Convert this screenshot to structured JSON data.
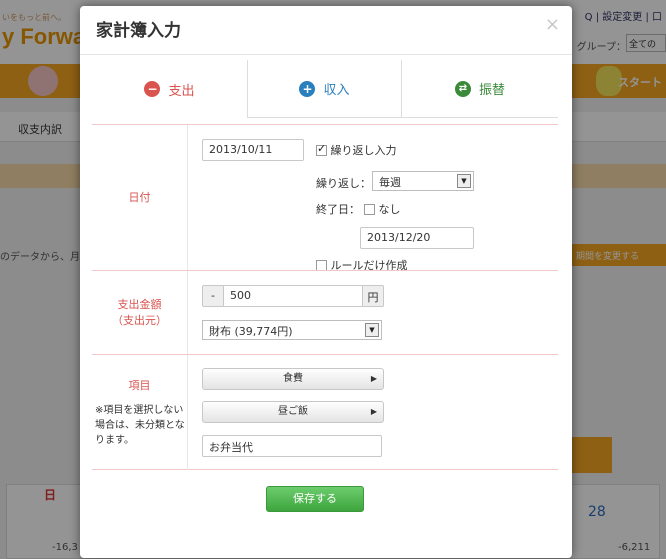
{
  "background": {
    "logo_tagline": "いをもっと前へ。",
    "logo_text": "y Forwa",
    "top_links": "Q | 設定変更 | 口",
    "group_label": "グループ：",
    "group_select": "全ての",
    "start_label": "スタート",
    "tab_label": "収支内訳",
    "text_left": "のデータから、月",
    "btn_right": "期間を変更する",
    "sunday": "日",
    "day_28": "28",
    "neg_left": "-16,3",
    "neg_right": "-6,211"
  },
  "modal": {
    "title": "家計簿入力",
    "close": "×",
    "tabs": [
      {
        "label": "支出",
        "icon": "minus-circle-icon",
        "icon_glyph": "−",
        "color": "#d9534f"
      },
      {
        "label": "収入",
        "icon": "plus-circle-icon",
        "icon_glyph": "+",
        "color": "#2a7fbd"
      },
      {
        "label": "振替",
        "icon": "swap-circle-icon",
        "icon_glyph": "⇄",
        "color": "#3a8a3a"
      }
    ],
    "date_section": {
      "label": "日付",
      "date_value": "2013/10/11",
      "repeat_checkbox_label": "繰り返し入力",
      "repeat_checked": true,
      "repeat_label": "繰り返し：",
      "repeat_select": "毎週",
      "end_label": "終了日：",
      "end_none_label": "なし",
      "end_none_checked": false,
      "end_date_value": "2013/12/20",
      "rule_only_label": "ルールだけ作成",
      "rule_only_checked": false
    },
    "amount_section": {
      "label_line1": "支出金額",
      "label_line2": "（支出元）",
      "sign": "-",
      "amount_value": "500",
      "unit": "円",
      "account_select": "財布 (39,774円)"
    },
    "item_section": {
      "label": "項目",
      "note": "※項目を選択しない場合は、未分類となります。",
      "category_button": "食費",
      "subcategory_button": "昼ご飯",
      "memo_value": "お弁当代"
    },
    "save_label": "保存する"
  },
  "colors": {
    "accent_red": "#d9534f",
    "save_green": "#4cb24c",
    "brand_orange": "#f5a623"
  }
}
